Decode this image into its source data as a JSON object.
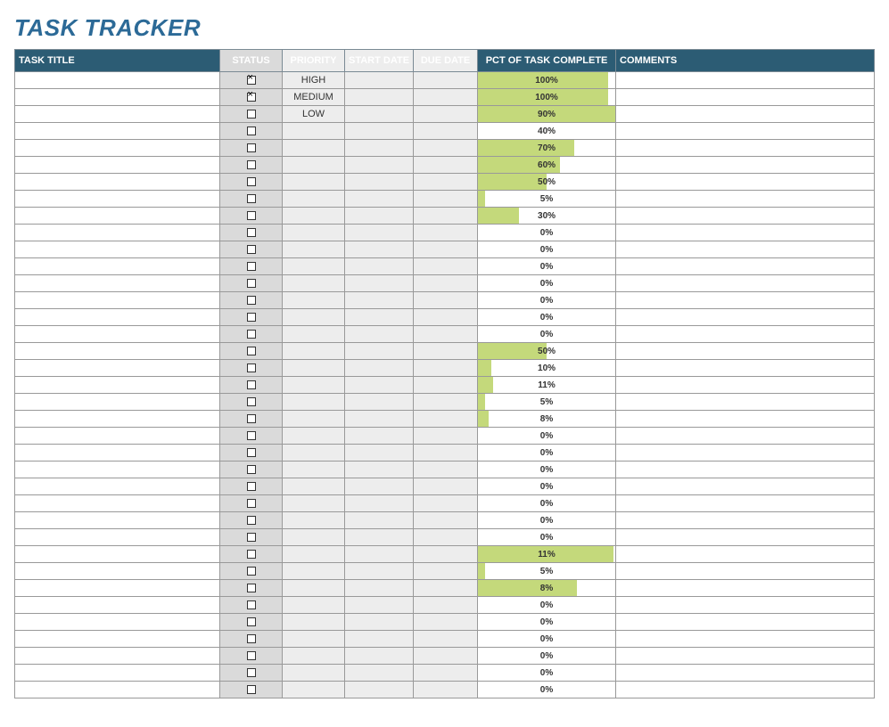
{
  "title": "TASK TRACKER",
  "headers": {
    "task_title": "TASK TITLE",
    "status": "STATUS",
    "priority": "PRIORITY",
    "start_date": "START DATE",
    "due_date": "DUE DATE",
    "pct_complete": "PCT OF TASK COMPLETE",
    "comments": "COMMENTS"
  },
  "rows": [
    {
      "task_title": "",
      "status_checked": true,
      "priority": "HIGH",
      "start_date": "",
      "due_date": "",
      "pct": 100,
      "pct_label": "100%",
      "bar_scale": 0.95,
      "comments": ""
    },
    {
      "task_title": "",
      "status_checked": true,
      "priority": "MEDIUM",
      "start_date": "",
      "due_date": "",
      "pct": 100,
      "pct_label": "100%",
      "bar_scale": 0.95,
      "comments": ""
    },
    {
      "task_title": "",
      "status_checked": false,
      "priority": "LOW",
      "start_date": "",
      "due_date": "",
      "pct": 90,
      "pct_label": "90%",
      "bar_scale": 1.15,
      "comments": ""
    },
    {
      "task_title": "",
      "status_checked": false,
      "priority": "",
      "start_date": "",
      "due_date": "",
      "pct": 40,
      "pct_label": "40%",
      "bar_scale": 0.0,
      "comments": ""
    },
    {
      "task_title": "",
      "status_checked": false,
      "priority": "",
      "start_date": "",
      "due_date": "",
      "pct": 70,
      "pct_label": "70%",
      "bar_scale": 1.0,
      "comments": ""
    },
    {
      "task_title": "",
      "status_checked": false,
      "priority": "",
      "start_date": "",
      "due_date": "",
      "pct": 60,
      "pct_label": "60%",
      "bar_scale": 1.0,
      "comments": ""
    },
    {
      "task_title": "",
      "status_checked": false,
      "priority": "",
      "start_date": "",
      "due_date": "",
      "pct": 50,
      "pct_label": "50%",
      "bar_scale": 1.0,
      "comments": ""
    },
    {
      "task_title": "",
      "status_checked": false,
      "priority": "",
      "start_date": "",
      "due_date": "",
      "pct": 5,
      "pct_label": "5%",
      "bar_scale": 1.0,
      "comments": ""
    },
    {
      "task_title": "",
      "status_checked": false,
      "priority": "",
      "start_date": "",
      "due_date": "",
      "pct": 30,
      "pct_label": "30%",
      "bar_scale": 1.0,
      "comments": ""
    },
    {
      "task_title": "",
      "status_checked": false,
      "priority": "",
      "start_date": "",
      "due_date": "",
      "pct": 0,
      "pct_label": "0%",
      "bar_scale": 0.0,
      "comments": ""
    },
    {
      "task_title": "",
      "status_checked": false,
      "priority": "",
      "start_date": "",
      "due_date": "",
      "pct": 0,
      "pct_label": "0%",
      "bar_scale": 0.0,
      "comments": ""
    },
    {
      "task_title": "",
      "status_checked": false,
      "priority": "",
      "start_date": "",
      "due_date": "",
      "pct": 0,
      "pct_label": "0%",
      "bar_scale": 0.0,
      "comments": ""
    },
    {
      "task_title": "",
      "status_checked": false,
      "priority": "",
      "start_date": "",
      "due_date": "",
      "pct": 0,
      "pct_label": "0%",
      "bar_scale": 0.0,
      "comments": ""
    },
    {
      "task_title": "",
      "status_checked": false,
      "priority": "",
      "start_date": "",
      "due_date": "",
      "pct": 0,
      "pct_label": "0%",
      "bar_scale": 0.0,
      "comments": ""
    },
    {
      "task_title": "",
      "status_checked": false,
      "priority": "",
      "start_date": "",
      "due_date": "",
      "pct": 0,
      "pct_label": "0%",
      "bar_scale": 0.0,
      "comments": ""
    },
    {
      "task_title": "",
      "status_checked": false,
      "priority": "",
      "start_date": "",
      "due_date": "",
      "pct": 0,
      "pct_label": "0%",
      "bar_scale": 0.0,
      "comments": ""
    },
    {
      "task_title": "",
      "status_checked": false,
      "priority": "",
      "start_date": "",
      "due_date": "",
      "pct": 50,
      "pct_label": "50%",
      "bar_scale": 1.0,
      "comments": ""
    },
    {
      "task_title": "",
      "status_checked": false,
      "priority": "",
      "start_date": "",
      "due_date": "",
      "pct": 10,
      "pct_label": "10%",
      "bar_scale": 1.0,
      "comments": ""
    },
    {
      "task_title": "",
      "status_checked": false,
      "priority": "",
      "start_date": "",
      "due_date": "",
      "pct": 11,
      "pct_label": "11%",
      "bar_scale": 1.0,
      "comments": ""
    },
    {
      "task_title": "",
      "status_checked": false,
      "priority": "",
      "start_date": "",
      "due_date": "",
      "pct": 5,
      "pct_label": "5%",
      "bar_scale": 1.0,
      "comments": ""
    },
    {
      "task_title": "",
      "status_checked": false,
      "priority": "",
      "start_date": "",
      "due_date": "",
      "pct": 8,
      "pct_label": "8%",
      "bar_scale": 1.0,
      "comments": ""
    },
    {
      "task_title": "",
      "status_checked": false,
      "priority": "",
      "start_date": "",
      "due_date": "",
      "pct": 0,
      "pct_label": "0%",
      "bar_scale": 0.0,
      "comments": ""
    },
    {
      "task_title": "",
      "status_checked": false,
      "priority": "",
      "start_date": "",
      "due_date": "",
      "pct": 0,
      "pct_label": "0%",
      "bar_scale": 0.0,
      "comments": ""
    },
    {
      "task_title": "",
      "status_checked": false,
      "priority": "",
      "start_date": "",
      "due_date": "",
      "pct": 0,
      "pct_label": "0%",
      "bar_scale": 0.0,
      "comments": ""
    },
    {
      "task_title": "",
      "status_checked": false,
      "priority": "",
      "start_date": "",
      "due_date": "",
      "pct": 0,
      "pct_label": "0%",
      "bar_scale": 0.0,
      "comments": ""
    },
    {
      "task_title": "",
      "status_checked": false,
      "priority": "",
      "start_date": "",
      "due_date": "",
      "pct": 0,
      "pct_label": "0%",
      "bar_scale": 0.0,
      "comments": ""
    },
    {
      "task_title": "",
      "status_checked": false,
      "priority": "",
      "start_date": "",
      "due_date": "",
      "pct": 0,
      "pct_label": "0%",
      "bar_scale": 0.0,
      "comments": ""
    },
    {
      "task_title": "",
      "status_checked": false,
      "priority": "",
      "start_date": "",
      "due_date": "",
      "pct": 0,
      "pct_label": "0%",
      "bar_scale": 0.0,
      "comments": ""
    },
    {
      "task_title": "",
      "status_checked": false,
      "priority": "",
      "start_date": "",
      "due_date": "",
      "pct": 11,
      "pct_label": "11%",
      "bar_scale": 9.0,
      "comments": ""
    },
    {
      "task_title": "",
      "status_checked": false,
      "priority": "",
      "start_date": "",
      "due_date": "",
      "pct": 5,
      "pct_label": "5%",
      "bar_scale": 1.0,
      "comments": ""
    },
    {
      "task_title": "",
      "status_checked": false,
      "priority": "",
      "start_date": "",
      "due_date": "",
      "pct": 8,
      "pct_label": "8%",
      "bar_scale": 9.0,
      "comments": ""
    },
    {
      "task_title": "",
      "status_checked": false,
      "priority": "",
      "start_date": "",
      "due_date": "",
      "pct": 0,
      "pct_label": "0%",
      "bar_scale": 0.0,
      "comments": ""
    },
    {
      "task_title": "",
      "status_checked": false,
      "priority": "",
      "start_date": "",
      "due_date": "",
      "pct": 0,
      "pct_label": "0%",
      "bar_scale": 0.0,
      "comments": ""
    },
    {
      "task_title": "",
      "status_checked": false,
      "priority": "",
      "start_date": "",
      "due_date": "",
      "pct": 0,
      "pct_label": "0%",
      "bar_scale": 0.0,
      "comments": ""
    },
    {
      "task_title": "",
      "status_checked": false,
      "priority": "",
      "start_date": "",
      "due_date": "",
      "pct": 0,
      "pct_label": "0%",
      "bar_scale": 0.0,
      "comments": ""
    },
    {
      "task_title": "",
      "status_checked": false,
      "priority": "",
      "start_date": "",
      "due_date": "",
      "pct": 0,
      "pct_label": "0%",
      "bar_scale": 0.0,
      "comments": ""
    },
    {
      "task_title": "",
      "status_checked": false,
      "priority": "",
      "start_date": "",
      "due_date": "",
      "pct": 0,
      "pct_label": "0%",
      "bar_scale": 0.0,
      "comments": ""
    }
  ]
}
